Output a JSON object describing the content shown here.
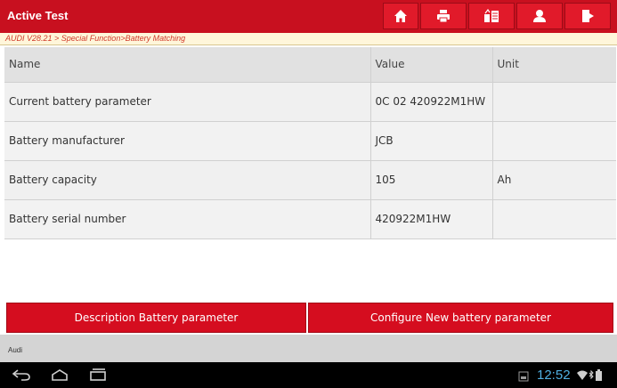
{
  "header": {
    "title": "Active Test",
    "icons": [
      "home-icon",
      "print-icon",
      "screenshot-icon",
      "user-icon",
      "exit-icon"
    ]
  },
  "breadcrumb": "AUDI V28.21 > Special Function>Battery Matching",
  "table": {
    "columns": [
      "Name",
      "Value",
      "Unit"
    ],
    "rows": [
      {
        "name": "Current battery parameter",
        "value": "0C 02 420922M1HW",
        "unit": ""
      },
      {
        "name": "Battery manufacturer",
        "value": "JCB",
        "unit": ""
      },
      {
        "name": "Battery capacity",
        "value": "105",
        "unit": "Ah"
      },
      {
        "name": "Battery serial number",
        "value": "420922M1HW",
        "unit": ""
      }
    ]
  },
  "actions": {
    "description_label": "Description  Battery parameter",
    "configure_label": "Configure  New battery parameter"
  },
  "status_bar": {
    "text": "Audi"
  },
  "system_bar": {
    "time": "12:52",
    "icons": [
      "back-icon",
      "home-nav-icon",
      "recent-apps-icon",
      "screenshot-notify-icon",
      "wifi-icon",
      "bluetooth-icon",
      "battery-icon"
    ]
  },
  "colors": {
    "header_red": "#c8101f",
    "button_red": "#d50d1f",
    "breadcrumb_text": "#d13a2a",
    "clock_blue": "#4fb0e3"
  }
}
